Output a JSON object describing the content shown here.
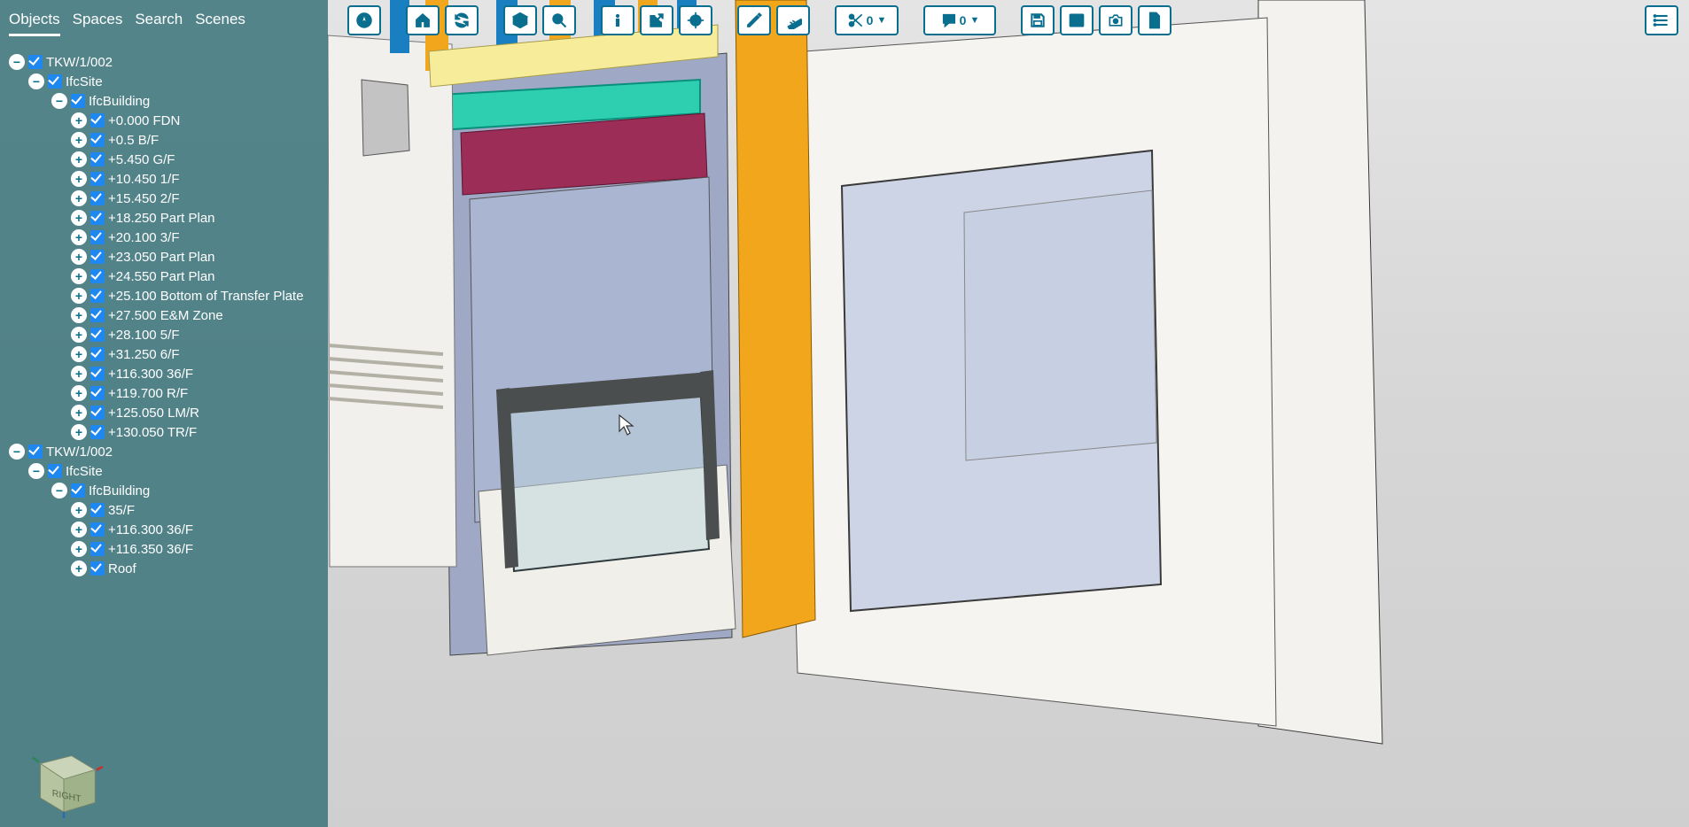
{
  "tabs": [
    "Objects",
    "Spaces",
    "Search",
    "Scenes"
  ],
  "activeTab": 0,
  "toolbar": {
    "scissors_count": "0",
    "comment_count": "0"
  },
  "navCube": {
    "faceLabel": "RIGHT"
  },
  "tree": [
    {
      "level": 0,
      "toggle": "-",
      "label": "TKW/1/002"
    },
    {
      "level": 1,
      "toggle": "-",
      "label": "IfcSite"
    },
    {
      "level": 2,
      "toggle": "-",
      "label": "IfcBuilding"
    },
    {
      "level": 3,
      "toggle": "+",
      "label": "+0.000 FDN"
    },
    {
      "level": 3,
      "toggle": "+",
      "label": "+0.5 B/F"
    },
    {
      "level": 3,
      "toggle": "+",
      "label": "+5.450 G/F"
    },
    {
      "level": 3,
      "toggle": "+",
      "label": "+10.450 1/F"
    },
    {
      "level": 3,
      "toggle": "+",
      "label": "+15.450 2/F"
    },
    {
      "level": 3,
      "toggle": "+",
      "label": "+18.250 Part Plan"
    },
    {
      "level": 3,
      "toggle": "+",
      "label": "+20.100 3/F"
    },
    {
      "level": 3,
      "toggle": "+",
      "label": "+23.050 Part Plan"
    },
    {
      "level": 3,
      "toggle": "+",
      "label": "+24.550 Part Plan"
    },
    {
      "level": 3,
      "toggle": "+",
      "label": "+25.100 Bottom of Transfer Plate"
    },
    {
      "level": 3,
      "toggle": "+",
      "label": "+27.500 E&M Zone"
    },
    {
      "level": 3,
      "toggle": "+",
      "label": "+28.100 5/F"
    },
    {
      "level": 3,
      "toggle": "+",
      "label": "+31.250 6/F"
    },
    {
      "level": 3,
      "toggle": "+",
      "label": "+116.300 36/F"
    },
    {
      "level": 3,
      "toggle": "+",
      "label": "+119.700 R/F"
    },
    {
      "level": 3,
      "toggle": "+",
      "label": "+125.050 LM/R"
    },
    {
      "level": 3,
      "toggle": "+",
      "label": "+130.050 TR/F"
    },
    {
      "level": 0,
      "toggle": "-",
      "label": "TKW/1/002"
    },
    {
      "level": 1,
      "toggle": "-",
      "label": "IfcSite"
    },
    {
      "level": 2,
      "toggle": "-",
      "label": "IfcBuilding"
    },
    {
      "level": 3,
      "toggle": "+",
      "label": "35/F"
    },
    {
      "level": 3,
      "toggle": "+",
      "label": "+116.300 36/F"
    },
    {
      "level": 3,
      "toggle": "+",
      "label": "+116.350 36/F"
    },
    {
      "level": 3,
      "toggle": "+",
      "label": "Roof"
    }
  ]
}
